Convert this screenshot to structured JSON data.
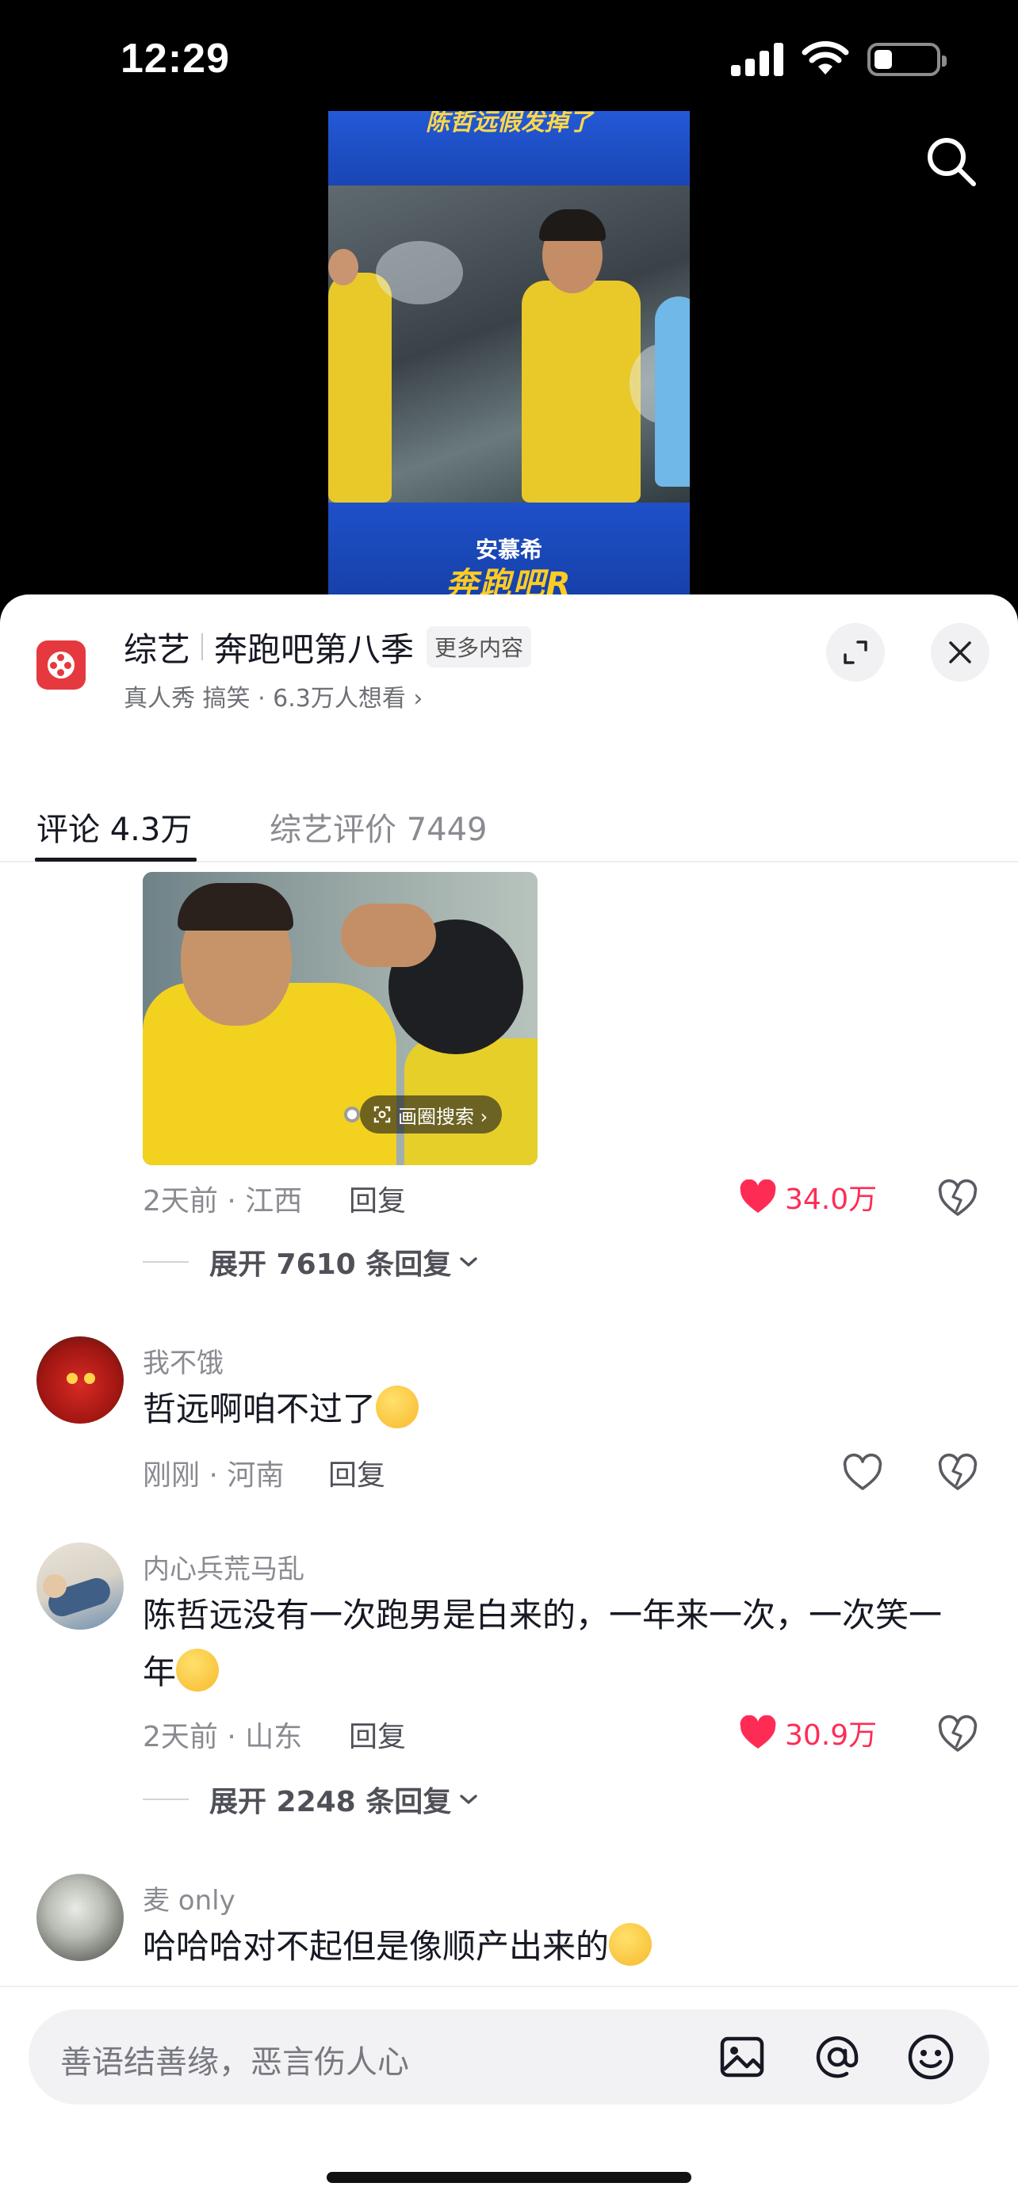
{
  "status": {
    "time": "12:29"
  },
  "video": {
    "caption_top": "陈哲远假发掉了",
    "logo_line1": "安慕希",
    "logo_line2": "奔跑吧R"
  },
  "header": {
    "category": "综艺",
    "show_title": "奔跑吧第八季",
    "more_label": "更多内容",
    "subtitle": "真人秀 搞笑 · 6.3万人想看 ›"
  },
  "tabs": [
    {
      "label": "评论 4.3万",
      "active": true
    },
    {
      "label": "综艺评价 7449",
      "active": false
    }
  ],
  "comments": [
    {
      "has_image": true,
      "image_search_label": "画圈搜索 ›",
      "meta": "2天前 · 江西",
      "reply_label": "回复",
      "likes": "34.0万",
      "liked": true,
      "expand_label": "展开 7610 条回复"
    },
    {
      "username": "我不饿",
      "text": "哲远啊咱不过了",
      "meta": "刚刚 · 河南",
      "reply_label": "回复",
      "liked": false
    },
    {
      "username": "内心兵荒马乱",
      "text": "陈哲远没有一次跑男是白来的，一年来一次，一次笑一年",
      "meta": "2天前 · 山东",
      "reply_label": "回复",
      "likes": "30.9万",
      "liked": true,
      "expand_label": "展开 2248 条回复"
    },
    {
      "username": "麦 only",
      "text": "哈哈哈对不起但是像顺产出来的"
    }
  ],
  "input": {
    "placeholder": "善语结善缘，恶言伤人心"
  },
  "icons": {
    "search": "search-icon",
    "expand": "expand-icon",
    "close": "close-icon",
    "like": "heart-icon",
    "dislike": "broken-heart-icon",
    "image": "image-icon",
    "mention": "at-icon",
    "emoji": "emoji-icon"
  },
  "colors": {
    "accent": "#fe2c55",
    "app_icon": "#e5393f"
  }
}
